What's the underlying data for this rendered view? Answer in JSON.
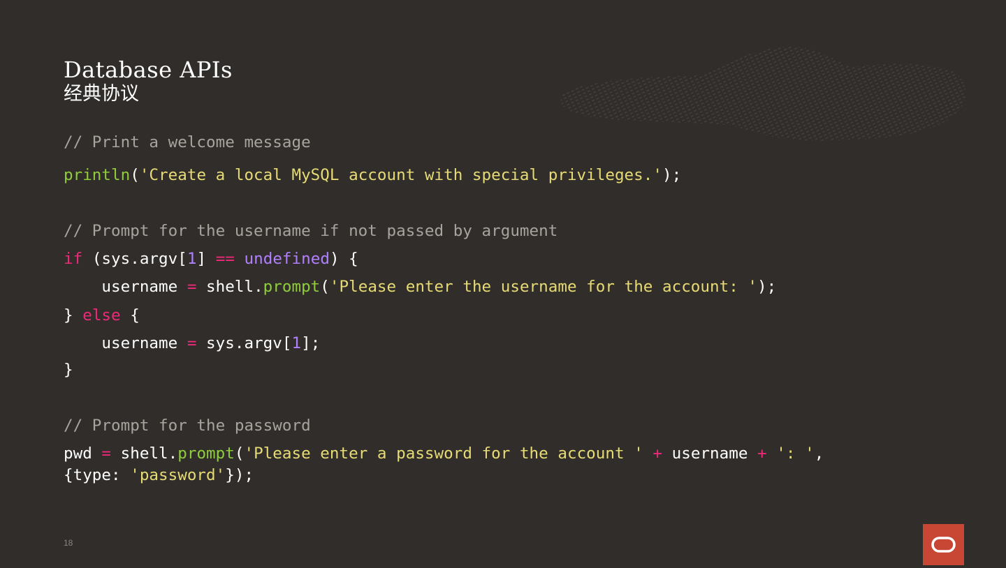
{
  "slide": {
    "title": "Database APIs",
    "subtitle": "经典协议",
    "page_number": "18",
    "colors": {
      "background": "#312d2a",
      "comment": "#a8a39d",
      "function": "#8fce3a",
      "string": "#e6db74",
      "keyword": "#f0287a",
      "number": "#ae81ff",
      "logo": "#c74634"
    },
    "logo_icon": "oracle-logo-icon"
  },
  "code": {
    "comment1": "// Print a welcome message",
    "l2_fn": "println",
    "l2_open": "(",
    "l2_str": "'Create a local MySQL account with special privileges.'",
    "l2_close": ");",
    "comment2": "// Prompt for the username if not passed by argument",
    "l4_if": "if",
    "l4_a": " (sys.argv[",
    "l4_num": "1",
    "l4_b": "] ",
    "l4_eq": "==",
    "l4_sp": " ",
    "l4_und": "undefined",
    "l4_c": ") {",
    "l5_a": "    username ",
    "l5_eq": "=",
    "l5_b": " shell.",
    "l5_fn": "prompt",
    "l5_open": "(",
    "l5_str": "'Please enter the username for the account: '",
    "l5_close": ");",
    "l6_a": "} ",
    "l6_else": "else",
    "l6_b": " {",
    "l7_a": "    username ",
    "l7_eq": "=",
    "l7_b": " sys.argv[",
    "l7_num": "1",
    "l7_c": "];",
    "l8": "}",
    "comment3": "// Prompt for the password",
    "l10_a": "pwd ",
    "l10_eq": "=",
    "l10_b": " shell.",
    "l10_fn": "prompt",
    "l10_open": "(",
    "l10_str1": "'Please enter a password for the account '",
    "l10_sp1": " ",
    "l10_plus1": "+",
    "l10_mid": " username ",
    "l10_plus2": "+",
    "l10_sp2": " ",
    "l10_str2": "': '",
    "l10_end": ",",
    "l11_a": "{type: ",
    "l11_str": "'password'",
    "l11_b": "});"
  }
}
